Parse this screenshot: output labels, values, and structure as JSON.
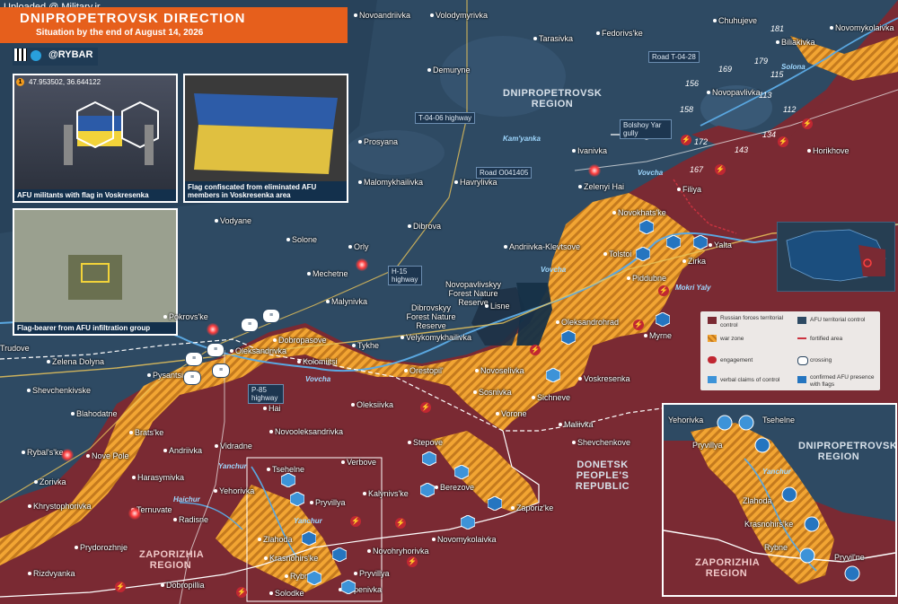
{
  "watermark": "Uploaded @ Military.ir",
  "header": {
    "title": "DNIPROPETROVSK DIRECTION",
    "subtitle": "Situation by the end of August 14, 2026",
    "brand": "@RYBAR"
  },
  "photos": [
    {
      "caption": "AFU militants with flag in Voskresenka",
      "coords": "47.953502, 36.644122",
      "pin": "1"
    },
    {
      "caption": "Flag confiscated from eliminated AFU members in Voskresenka area"
    },
    {
      "caption": "Flag-bearer from AFU infiltration group"
    }
  ],
  "regions": {
    "dnipro": "DNIPROPETROVSK REGION",
    "donetsk": "DONETSK PEOPLE'S REPUBLIC",
    "zaporizhia": "ZAPORIZHIA REGION"
  },
  "roads": {
    "t0406": "T-04-06 highway",
    "o041405": "Road O041405",
    "t0428": "Road T-04-28",
    "h15": "H-15 highway",
    "p85": "P-85 highway",
    "gully": "Bolshoy Yar gully"
  },
  "forests": {
    "novopavlivskyy": "Novopavlivskyy Forest Nature Reserve",
    "dibrovskyy": "Dibrovskyy Forest Nature Reserve"
  },
  "rivers": {
    "kamyanka": "Kam'yanka",
    "vovcha1": "Vovcha",
    "vovcha2": "Vovcha",
    "vovcha3": "Vovcha",
    "yanchur1": "Yanchur",
    "yanchur2": "Yanchur",
    "haichur": "Haichur",
    "mokri_yaly": "Mokri Yaly",
    "solona": "Solona"
  },
  "heights": [
    "181",
    "179",
    "169",
    "156",
    "158",
    "115",
    "113",
    "112",
    "134",
    "143",
    "172",
    "167"
  ],
  "settlements": [
    "Novoandriivka",
    "Volodymyrivka",
    "Tarasivka",
    "Fedorivs'ke",
    "Chuhujeve",
    "Biliakivka",
    "Novomykolaivka",
    "Demuryne",
    "Novopavlivka",
    "Prosyana",
    "Ivanivka",
    "Filiya",
    "Horikhove",
    "Malomykhailivka",
    "Havrylivka",
    "Zelenyi Hai",
    "Novokhats'ke",
    "Vodyane",
    "Solone",
    "Dibrova",
    "Andriivka-Klevtsove",
    "Tolstoi",
    "Yalta",
    "Zirka",
    "Orly",
    "Mechetne",
    "Piddubne",
    "Malynivka",
    "Lisne",
    "Oleksandrohrad",
    "Myrne",
    "Pokrovs'ke",
    "Dobropasove",
    "Tykhe",
    "Velykomykhailivka",
    "Trudove",
    "Oleksandrivka",
    "Kolomiitsi",
    "Zelena Dolyna",
    "Orestopil'",
    "Novoselivka",
    "Voskresenka",
    "Pysantsi",
    "Shevchenkivske",
    "Sosnivka",
    "Sichneve",
    "Blahodatne",
    "Hai",
    "Oleksiivka",
    "Vorone",
    "Maliivka",
    "Brats'ke",
    "Novooleksandrivka",
    "Andriivka",
    "Shevchenkove",
    "Vidradne",
    "Stepove",
    "Rybal's'ke",
    "Nove Pole",
    "Harasymivka",
    "Verbove",
    "Tsehelne",
    "Zorivka",
    "Kalynivs'ke",
    "Berezove",
    "Khrystophorivka",
    "Yehorivka",
    "Pryvillya",
    "Zaporiz'ke",
    "Ternuvate",
    "Radisne",
    "Zlahoda",
    "Novomykolaivka",
    "Prydorozhnje",
    "Novohryhorivka",
    "Krasnohirs'ke",
    "Rizdvyanka",
    "Pryvillya",
    "Dobropillia",
    "Uspenivka",
    "Rybne",
    "Solodke"
  ],
  "inset": {
    "settlements": [
      "Yehorivka",
      "Tsehelne",
      "Pryvillya",
      "Zlahoda",
      "Krasnohirs'ke",
      "Rybne",
      "Pryvil'ne"
    ],
    "river": "Yanchur",
    "region_dnipro": "DNIPROPETROVSK REGION",
    "region_zap": "ZAPORIZHIA REGION"
  },
  "legend": {
    "russian": "Russian forces territorial control",
    "afu": "AFU territorial control",
    "warzone": "war zone",
    "fortified": "fortified area",
    "engagement": "engagement",
    "crossing": "crossing",
    "verbal": "verbal claims of control",
    "flags": "confirmed AFU presence with flags"
  },
  "colors": {
    "afu": "#2e4a63",
    "russian": "#7a2a33",
    "warzone": "#f0a030",
    "accent": "#e65f1c"
  }
}
